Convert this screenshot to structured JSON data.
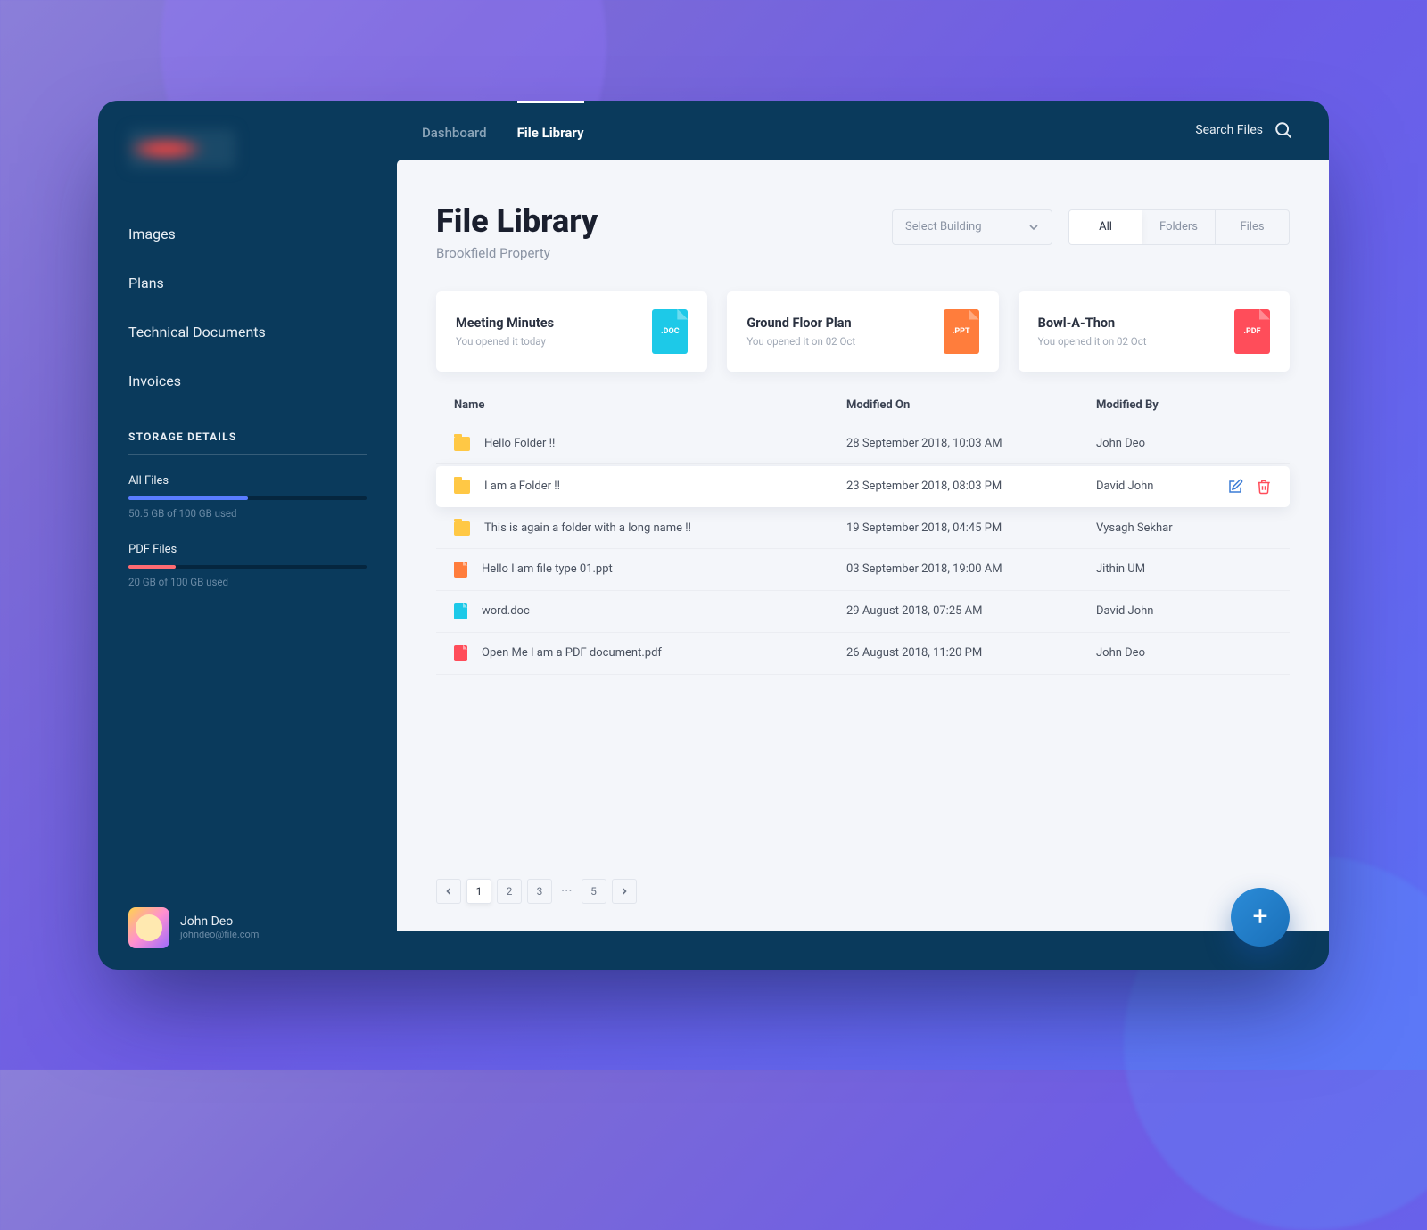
{
  "nav": [
    {
      "label": "Images",
      "key": "images"
    },
    {
      "label": "Plans",
      "key": "plans"
    },
    {
      "label": "Technical Documents",
      "key": "tech-docs"
    },
    {
      "label": "Invoices",
      "key": "invoices"
    }
  ],
  "storage": {
    "title": "STORAGE DETAILS",
    "sections": [
      {
        "label": "All Files",
        "sub": "50.5 GB of 100 GB used",
        "fill": "blue"
      },
      {
        "label": "PDF Files",
        "sub": "20 GB of 100 GB used",
        "fill": "red"
      }
    ]
  },
  "user": {
    "name": "John Deo",
    "email": "johndeo@file.com"
  },
  "tabs": [
    {
      "label": "Dashboard",
      "key": "dashboard",
      "active": false
    },
    {
      "label": "File Library",
      "key": "file-library",
      "active": true
    }
  ],
  "search_label": "Search Files",
  "page": {
    "title": "File Library",
    "subtitle": "Brookfield Property"
  },
  "select_building": "Select Building",
  "filters": [
    {
      "label": "All",
      "active": true
    },
    {
      "label": "Folders",
      "active": false
    },
    {
      "label": "Files",
      "active": false
    }
  ],
  "cards": [
    {
      "title": "Meeting Minutes",
      "sub": "You opened it today",
      "ext": ".DOC",
      "cls": "fi-doc"
    },
    {
      "title": "Ground Floor Plan",
      "sub": "You opened it on 02 Oct",
      "ext": ".PPT",
      "cls": "fi-ppt"
    },
    {
      "title": "Bowl-A-Thon",
      "sub": "You opened it on 02 Oct",
      "ext": ".PDF",
      "cls": "fi-pdf"
    }
  ],
  "columns": {
    "name": "Name",
    "modified": "Modified On",
    "by": "Modified By"
  },
  "rows": [
    {
      "icon": "folder",
      "name": "Hello Folder !!",
      "modified": "28 September 2018, 10:03 AM",
      "by": "John Deo",
      "hl": false
    },
    {
      "icon": "folder",
      "name": "I am a Folder !!",
      "modified": "23 September 2018, 08:03 PM",
      "by": "David John",
      "hl": true
    },
    {
      "icon": "folder",
      "name": "This is again a folder with a long name !!",
      "modified": "19 September 2018, 04:45 PM",
      "by": "Vysagh Sekhar",
      "hl": false
    },
    {
      "icon": "ppt",
      "name": "Hello I am file type 01.ppt",
      "modified": "03 September 2018, 19:00 AM",
      "by": "Jithin UM",
      "hl": false
    },
    {
      "icon": "doc",
      "name": "word.doc",
      "modified": "29 August 2018, 07:25 AM",
      "by": "David John",
      "hl": false
    },
    {
      "icon": "pdf",
      "name": "Open Me I am a PDF document.pdf",
      "modified": "26 August 2018, 11:20 PM",
      "by": "John Deo",
      "hl": false
    }
  ],
  "pagination": {
    "pages": [
      "1",
      "2",
      "3"
    ],
    "last": "5",
    "active": "1"
  }
}
